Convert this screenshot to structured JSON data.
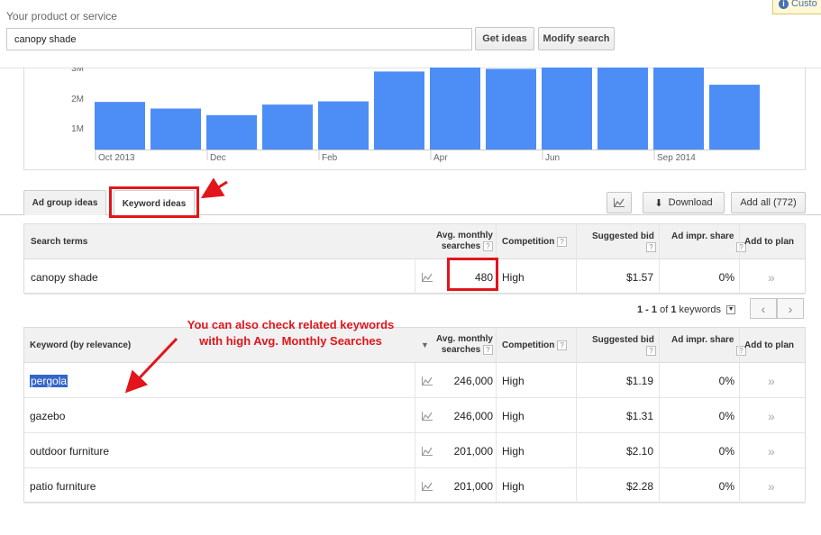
{
  "search": {
    "label": "Your product or service",
    "value": "canopy shade",
    "get_ideas": "Get ideas",
    "modify_search": "Modify search"
  },
  "notice": {
    "text": "Custo"
  },
  "chart_data": {
    "type": "bar",
    "ytick_labels": [
      "3M",
      "2M",
      "1M"
    ],
    "xtick_labels": [
      "Oct 2013",
      "Dec",
      "Feb",
      "Apr",
      "Jun",
      "Sep 2014"
    ],
    "values": [
      1800000,
      1550000,
      1300000,
      1700000,
      1820000,
      2950000,
      3100000,
      3050000,
      3100000,
      3100000,
      3100000,
      2450000
    ],
    "ylim": [
      0,
      3000000
    ],
    "bar_color": "#4d8df6"
  },
  "tabs": {
    "ad_group": "Ad group ideas",
    "keyword": "Keyword ideas",
    "download": "Download",
    "add_all": "Add all (772)"
  },
  "search_terms": {
    "headers": {
      "term": "Search terms",
      "avg_line1": "Avg. monthly",
      "avg_line2": "searches",
      "competition": "Competition",
      "bid": "Suggested bid",
      "share": "Ad impr. share",
      "add": "Add to plan"
    },
    "rows": [
      {
        "term": "canopy shade",
        "searches": "480",
        "competition": "High",
        "bid": "$1.57",
        "share": "0%"
      }
    ]
  },
  "pager": {
    "range": "1 - 1",
    "of": "of",
    "total": "1",
    "unit": "keywords"
  },
  "keywords": {
    "headers": {
      "term": "Keyword (by relevance)",
      "avg_line1": "Avg. monthly",
      "avg_line2": "searches",
      "competition": "Competition",
      "bid": "Suggested bid",
      "share": "Ad impr. share",
      "add": "Add to plan"
    },
    "rows": [
      {
        "term": "pergola",
        "searches": "246,000",
        "competition": "High",
        "bid": "$1.19",
        "share": "0%"
      },
      {
        "term": "gazebo",
        "searches": "246,000",
        "competition": "High",
        "bid": "$1.31",
        "share": "0%"
      },
      {
        "term": "outdoor furniture",
        "searches": "201,000",
        "competition": "High",
        "bid": "$2.10",
        "share": "0%"
      },
      {
        "term": "patio furniture",
        "searches": "201,000",
        "competition": "High",
        "bid": "$2.28",
        "share": "0%"
      }
    ]
  },
  "annotation": {
    "line1": "You can also check related keywords",
    "line2": "with high Avg. Monthly Searches"
  },
  "colors": {
    "annotation_red": "#e3141b",
    "highlight_blue": "#3366cc"
  }
}
